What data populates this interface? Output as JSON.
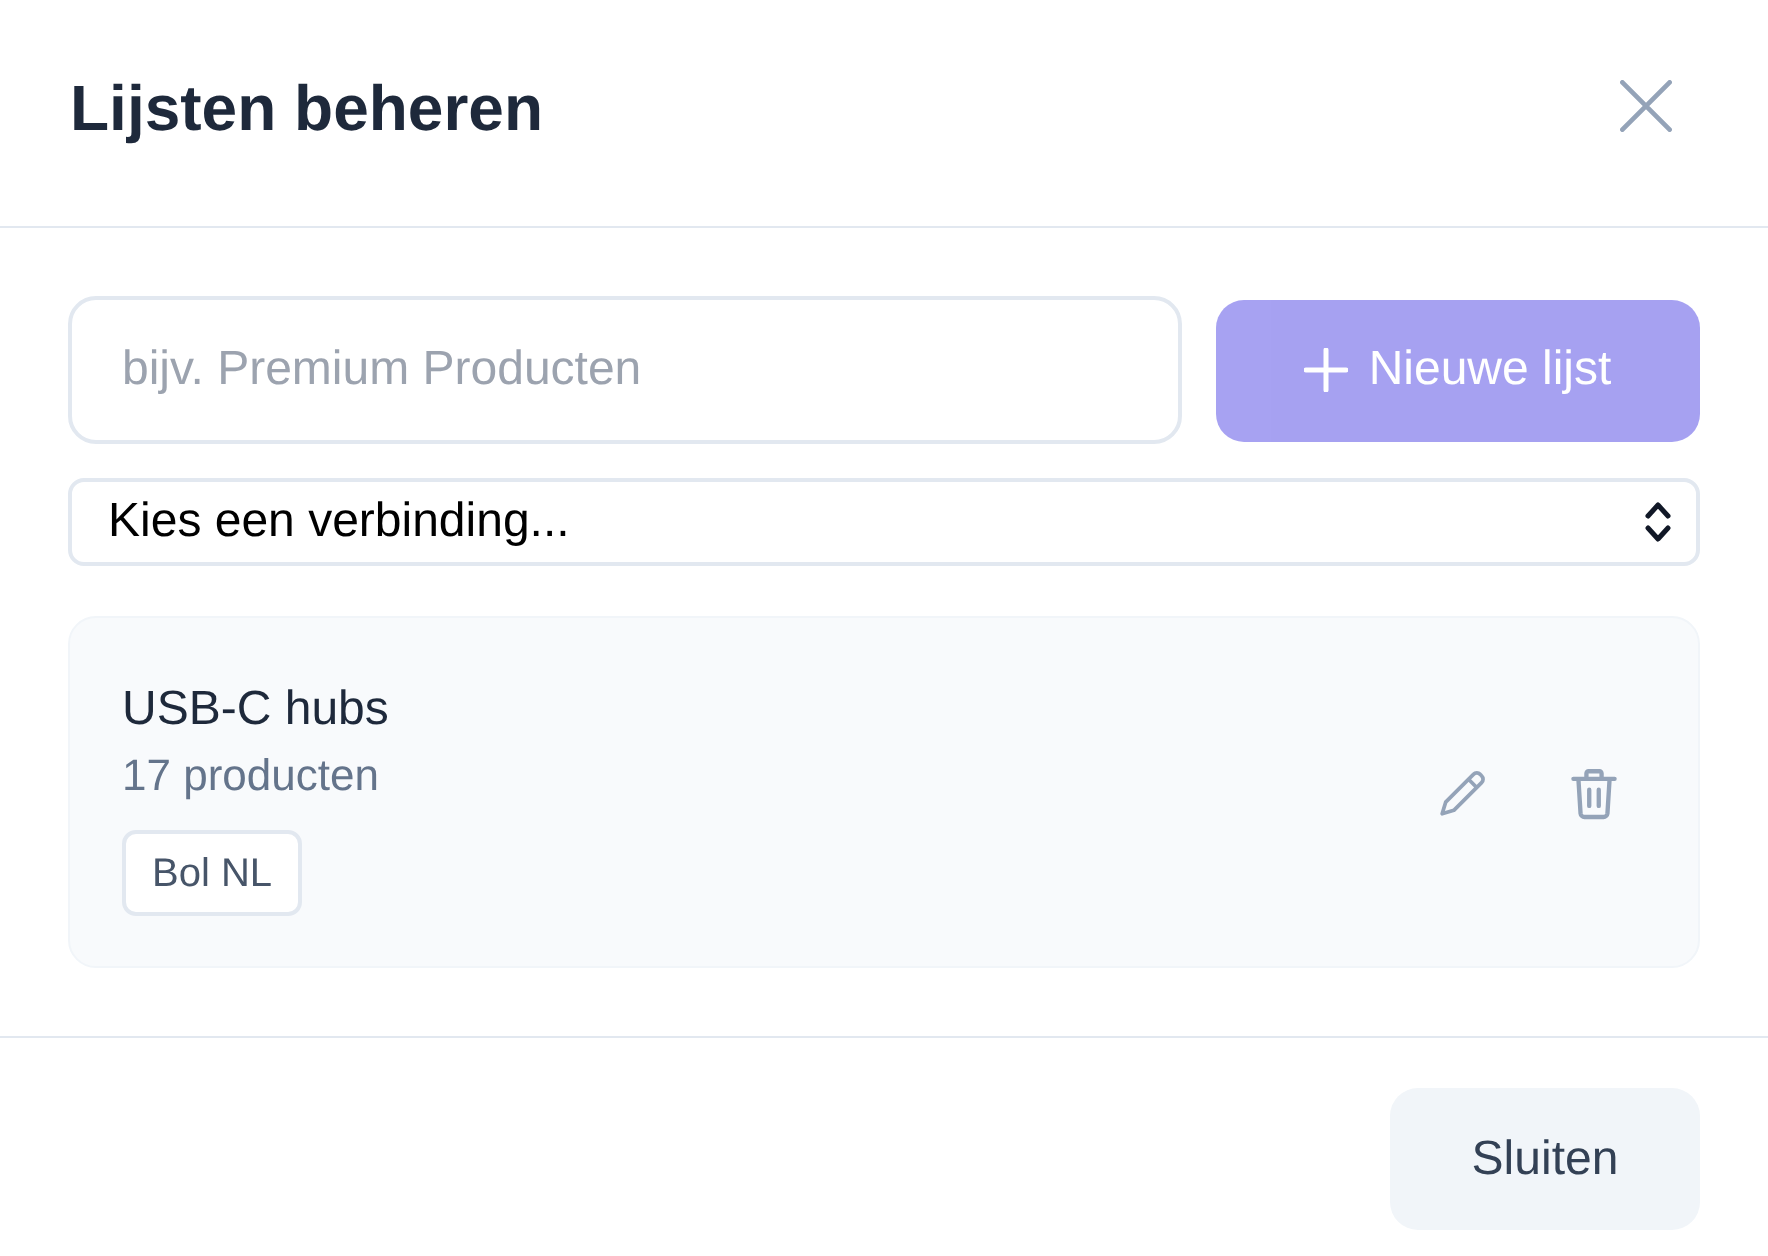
{
  "dialog": {
    "title": "Lijsten beheren"
  },
  "name_field": {
    "placeholder": "bijv. Premium Producten"
  },
  "new_list_button": {
    "label": "Nieuwe lijst",
    "disabled": true
  },
  "connection_select": {
    "value": "Kies een verbinding..."
  },
  "lists": [
    {
      "name": "USB-C hubs",
      "count": "17 producten",
      "tag": "Bol NL"
    }
  ],
  "footer": {
    "close_button": "Sluiten"
  }
}
